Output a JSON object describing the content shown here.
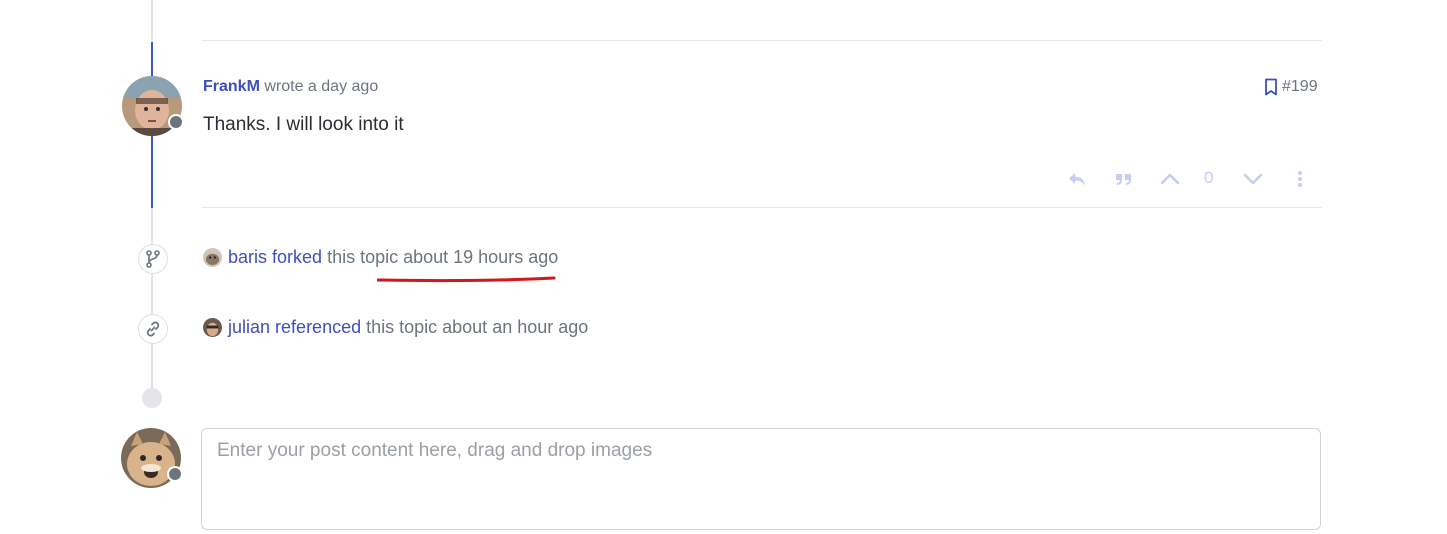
{
  "post": {
    "username": "FrankM",
    "meta_text": "wrote a day ago",
    "post_number": "#199",
    "body": "Thanks. I will look into it",
    "vote_count": "0"
  },
  "events": [
    {
      "user": "baris",
      "action": "forked",
      "rest": "this topic about 19 hours ago",
      "icon": "fork-icon"
    },
    {
      "user": "julian",
      "action": "referenced",
      "rest": "this topic about an hour ago",
      "icon": "link-icon"
    }
  ],
  "composer": {
    "placeholder": "Enter your post content here, drag and drop images"
  },
  "colors": {
    "accent": "#3f4fbd",
    "timeline_active": "#3a5bc7",
    "annotation": "#d4151b"
  }
}
